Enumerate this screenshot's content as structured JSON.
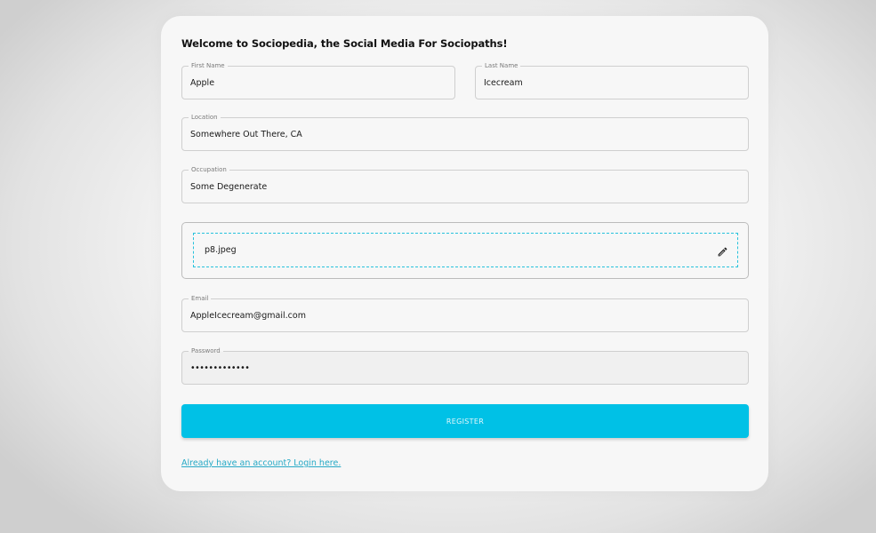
{
  "form": {
    "welcome_text": "Welcome to Sociopedia, the Social Media For Sociopaths!",
    "first_name": {
      "label": "First Name",
      "value": "Apple"
    },
    "last_name": {
      "label": "Last Name",
      "value": "Icecream"
    },
    "location": {
      "label": "Location",
      "value": "Somewhere Out There, CA"
    },
    "occupation": {
      "label": "Occupation",
      "value": "Some Degenerate"
    },
    "picture": {
      "filename": "p8.jpeg",
      "icon": "edit-pencil-icon"
    },
    "email": {
      "label": "Email",
      "value": "AppleIcecream@gmail.com"
    },
    "password": {
      "label": "Password",
      "value": "•••••••••••••"
    },
    "register_label": "REGISTER",
    "login_link": "Already have an account? Login here."
  },
  "colors": {
    "accent": "#00c1e6",
    "dropzone_border": "#27c2dc",
    "link": "#26a9c6"
  }
}
